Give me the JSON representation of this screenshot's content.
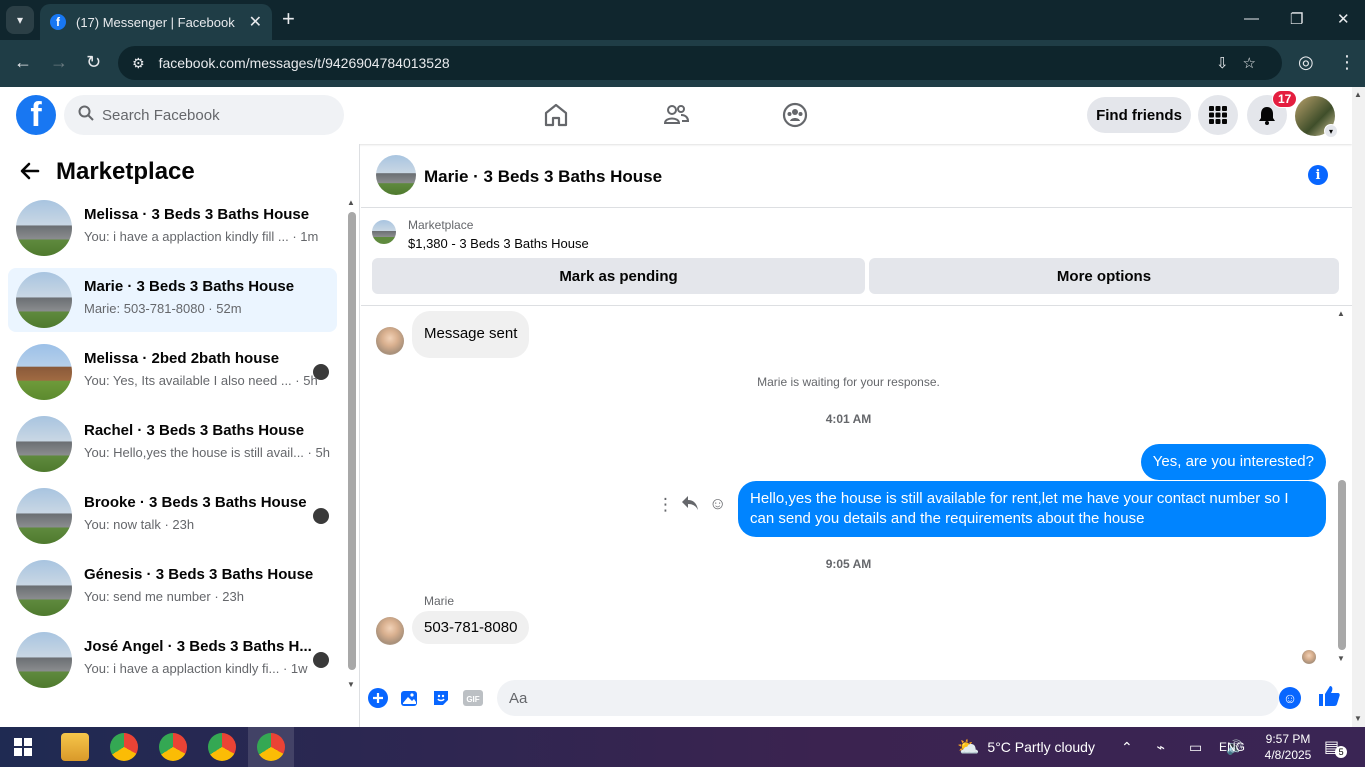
{
  "browser": {
    "tab_title": "(17) Messenger | Facebook",
    "url": "facebook.com/messages/t/9426904784013528"
  },
  "fb": {
    "search_placeholder": "Search Facebook",
    "find_friends": "Find friends",
    "notif_count": "17"
  },
  "left": {
    "heading": "Marketplace",
    "conversations": [
      {
        "name": "Melissa · 3 Beds 3 Baths House",
        "preview": "You: i have a applaction kindly fill ... · 1m",
        "active": false,
        "seen": false
      },
      {
        "name": "Marie · 3 Beds 3 Baths House",
        "preview": "Marie: 503-781-8080 · 52m",
        "active": true,
        "seen": false
      },
      {
        "name": "Melissa · 2bed 2bath house",
        "preview": "You: Yes, Its available I also need ... · 5h",
        "active": false,
        "seen": true
      },
      {
        "name": "Rachel · 3 Beds 3 Baths House",
        "preview": "You: Hello,yes the house is still avail... · 5h",
        "active": false,
        "seen": false
      },
      {
        "name": "Brooke · 3 Beds 3 Baths House",
        "preview": "You: now talk · 23h",
        "active": false,
        "seen": true
      },
      {
        "name": "Génesis · 3 Beds 3 Baths House",
        "preview": "You: send me number · 23h",
        "active": false,
        "seen": false
      },
      {
        "name": "José Angel · 3 Beds 3 Baths H...",
        "preview": "You: i have a applaction kindly fi... · 1w",
        "active": false,
        "seen": true
      }
    ]
  },
  "chat": {
    "title": "Marie · 3 Beds 3 Baths House",
    "marketplace_label": "Marketplace",
    "listing": "$1,380 - 3 Beds 3 Baths House",
    "btn_pending": "Mark as pending",
    "btn_more": "More options",
    "msg_sent": "Message sent",
    "waiting": "Marie is waiting for your response.",
    "time1": "4:01 AM",
    "out1": "Yes, are you interested?",
    "out2": "Hello,yes the house is still available for rent,let me have your contact number so I can send you details and the requirements about the house",
    "time2": "9:05 AM",
    "sender": "Marie",
    "in1": "503-781-8080",
    "composer_placeholder": "Aa"
  },
  "taskbar": {
    "weather": "5°C  Partly cloudy",
    "lang": "ENG",
    "time": "9:57 PM",
    "date": "4/8/2025",
    "notif": "5"
  }
}
